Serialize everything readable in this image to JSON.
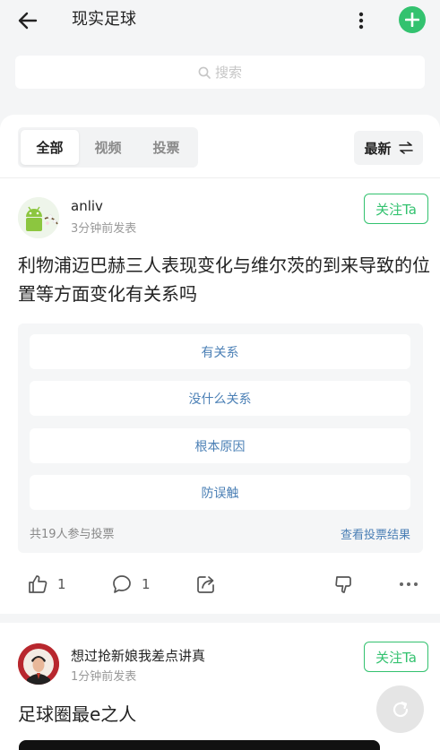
{
  "header": {
    "title": "现实足球"
  },
  "search": {
    "placeholder": "搜索"
  },
  "tabs": [
    {
      "label": "全部",
      "active": true
    },
    {
      "label": "视频",
      "active": false
    },
    {
      "label": "投票",
      "active": false
    }
  ],
  "sort": {
    "label": "最新"
  },
  "posts": [
    {
      "username": "anliv",
      "time": "3分钟前发表",
      "follow_label": "关注Ta",
      "text": "利物浦迈巴赫三人表现变化与维尔茨的到来导致的位置等方面变化有关系吗",
      "poll": {
        "options": [
          "有关系",
          "没什么关系",
          "根本原因",
          "防误触"
        ],
        "participants": "共19人参与投票",
        "view_results": "查看投票结果"
      },
      "likes": "1",
      "comments": "1"
    },
    {
      "username": "想过抢新娘我差点讲真",
      "time": "1分钟前发表",
      "follow_label": "关注Ta",
      "text": "足球圈最e之人"
    }
  ],
  "colors": {
    "accent": "#33c26f",
    "link": "#4a7fb5",
    "muted": "#999999"
  }
}
